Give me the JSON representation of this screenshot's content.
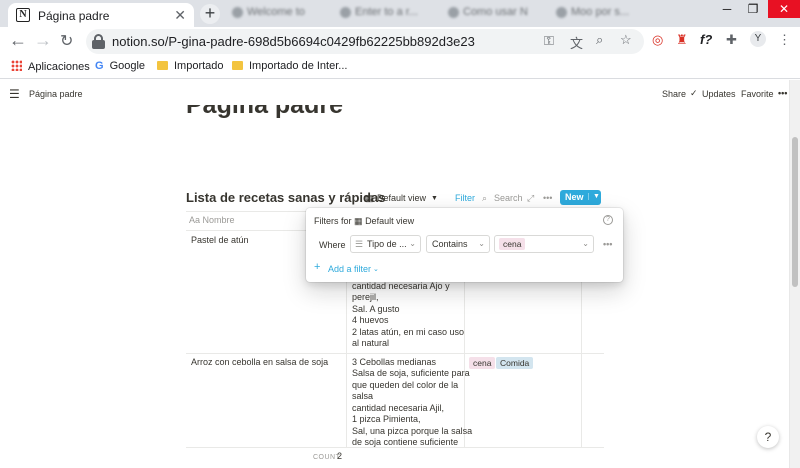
{
  "browser": {
    "active_tab": {
      "title": "Página padre",
      "favicon_letter": "N"
    },
    "background_tabs": [
      "Welcome to",
      "Enter to a r...",
      "Como usar N",
      "Moo por s..."
    ],
    "url": "notion.so/P-gina-padre-698d5b6694c0429fb62225bb892d3e23",
    "profile_initial": "Y",
    "bookmarks": [
      "Aplicaciones",
      "Google",
      "Importado",
      "Importado de Inter..."
    ]
  },
  "notion_header": {
    "breadcrumb": "Página padre",
    "actions": {
      "share": "Share",
      "updates": "Updates",
      "favorite": "Favorite",
      "more": "•••"
    }
  },
  "page": {
    "title": "Página padre"
  },
  "database": {
    "title": "Lista de recetas sanas y rápidas",
    "view": "Default view",
    "filter_label": "Filter",
    "search_label": "Search",
    "new_label": "New",
    "column_name_header": "Nombre",
    "rows": [
      {
        "name": "Pastel de atún",
        "ingredients": [
          "cantidad necesaria Ajo y",
          "perejil,",
          "Sal. A gusto",
          "4 huevos",
          "2 latas atún, en mi caso uso",
          "al natural"
        ]
      },
      {
        "name": "Arroz con cebolla en salsa de soja",
        "ingredients": [
          "3 Cebollas medianas",
          "Salsa de soja, suficiente para",
          "que queden del color de la",
          "salsa",
          "cantidad necesaria Ajil,",
          "1 pizca Pimienta,",
          "Sal, una pizca porque la salsa",
          "de soja contiene suficiente"
        ],
        "tags": [
          "cena",
          "Comida"
        ]
      }
    ],
    "count_label": "COUNT",
    "count_value": "2"
  },
  "filter_popup": {
    "header_prefix": "Filters for",
    "header_view": "Default view",
    "where": "Where",
    "property": "Tipo de ...",
    "operator": "Contains",
    "value": "cena",
    "add_filter": "Add a filter"
  },
  "help_button": "?",
  "colors": {
    "accent_blue": "#2eaadc",
    "tag_cena": "#f5e0e9",
    "tag_comida": "#d3e5ef"
  }
}
